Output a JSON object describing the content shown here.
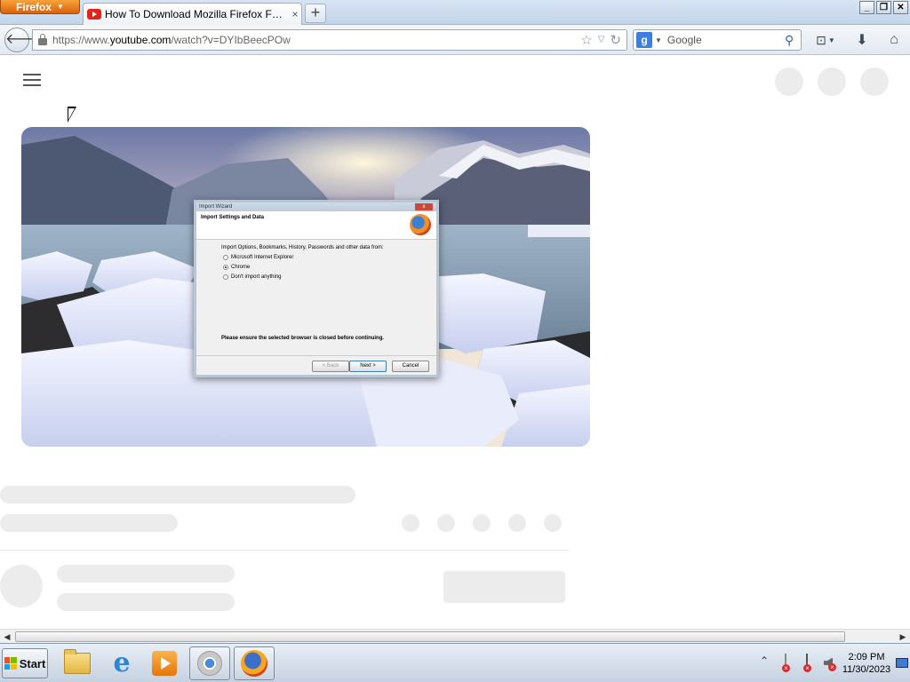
{
  "browser": {
    "menu_label": "Firefox",
    "tab": {
      "title": "How To Download Mozilla Firefox For Windo...",
      "close": "×"
    },
    "new_tab": "+",
    "window_controls": {
      "minimize": "_",
      "restore": "❐",
      "close": "✕"
    },
    "url": {
      "prefix": "https://www.",
      "host": "youtube.com",
      "path": "/watch?v=DYIbBeecPOw"
    },
    "search": {
      "engine_letter": "g",
      "placeholder": "Google"
    }
  },
  "video": {
    "dialog": {
      "title": "Import Wizard",
      "close": "x",
      "heading": "Import Settings and Data",
      "question": "Import Options, Bookmarks, History, Passwords and other data from:",
      "options": [
        {
          "label": "Microsoft Internet Explorer",
          "selected": false
        },
        {
          "label": "Chrome",
          "selected": true
        },
        {
          "label": "Don't import anything",
          "selected": false
        }
      ],
      "warning": "Please ensure the selected browser is closed before continuing.",
      "buttons": {
        "back": "< Back",
        "next": "Next >",
        "cancel": "Cancel"
      }
    }
  },
  "taskbar": {
    "start_label": "Start",
    "apps": [
      "folder-icon",
      "ie-icon",
      "media-player-icon",
      "chrome-icon",
      "firefox-icon"
    ],
    "ie_glyph": "e",
    "clock": {
      "time": "2:09 PM",
      "date": "11/30/2023"
    },
    "tray_expand": "⌃"
  },
  "colors": {
    "firefox_orange": "#e8790f",
    "youtube_red": "#e62117",
    "skeleton": "#ececec"
  }
}
